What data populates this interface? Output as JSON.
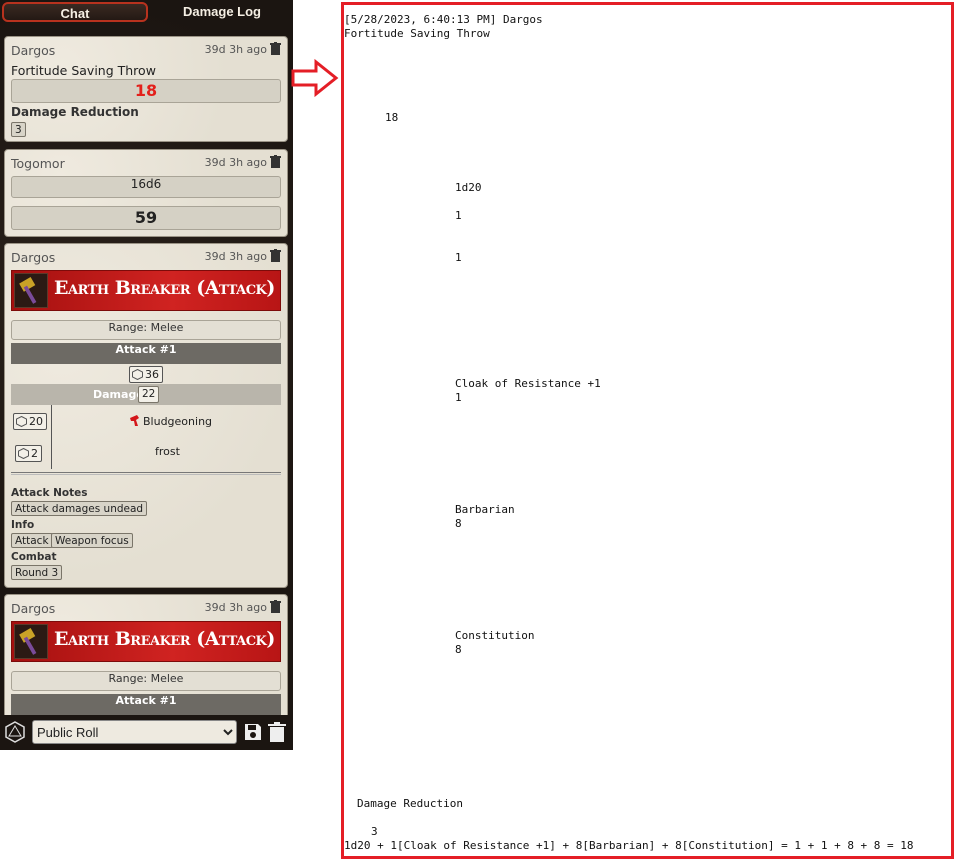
{
  "tabs": {
    "chat": "Chat",
    "damage_log": "Damage Log"
  },
  "cards": {
    "c1": {
      "sender": "Dargos",
      "time": "39d 3h ago",
      "subtitle": "Fortitude Saving Throw",
      "total": "18",
      "dr_label": "Damage Reduction",
      "dr_value": "3"
    },
    "c2": {
      "sender": "Togomor",
      "time": "39d 3h ago",
      "formula": "16d6",
      "total": "59"
    },
    "c3": {
      "sender": "Dargos",
      "time": "39d 3h ago",
      "title": "Earth Breaker (Attack)",
      "range": "Range: Melee",
      "attack": "Attack #1",
      "attack_roll": "36",
      "damage_label": "Damage",
      "damage_total": "22",
      "dmg1_roll": "20",
      "dmg1_type": "Bludgeoning",
      "dmg2_roll": "2",
      "dmg2_type": "frost",
      "attack_notes_label": "Attack Notes",
      "attack_note": "Attack damages undead",
      "info_label": "Info",
      "info_attack": "Attack",
      "info_focus": "Weapon focus",
      "combat_label": "Combat",
      "round": "Round 3"
    },
    "c4": {
      "sender": "Dargos",
      "time": "39d 3h ago",
      "title": "Earth Breaker (Attack)",
      "range": "Range: Melee",
      "attack": "Attack #1"
    }
  },
  "footer": {
    "roll_mode": "Public Roll",
    "roll_options": [
      "Public Roll"
    ]
  },
  "raw": {
    "line1": "[5/28/2023, 6:40:13 PM] Dargos",
    "line2": "Fortitude Saving Throw",
    "total": "18",
    "die": "1d20",
    "die_val1": "1",
    "die_val2": "1",
    "cloak_label": "Cloak of Resistance +1",
    "cloak_val": "1",
    "barb_label": "Barbarian",
    "barb_val": "8",
    "con_label": "Constitution",
    "con_val": "8",
    "dr_label": "Damage Reduction",
    "dr_val": "3",
    "formula": "1d20 + 1[Cloak of Resistance +1] + 8[Barbarian] + 8[Constitution] = 1 + 1 + 8 + 8 = 18"
  },
  "colors": {
    "accent_red": "#e41e26",
    "banner_red": "#c81d1b"
  },
  "icons": [
    "trash-icon",
    "d20-icon",
    "save-icon",
    "arrow-right-icon",
    "hammer-icon",
    "damage-type-icon"
  ]
}
